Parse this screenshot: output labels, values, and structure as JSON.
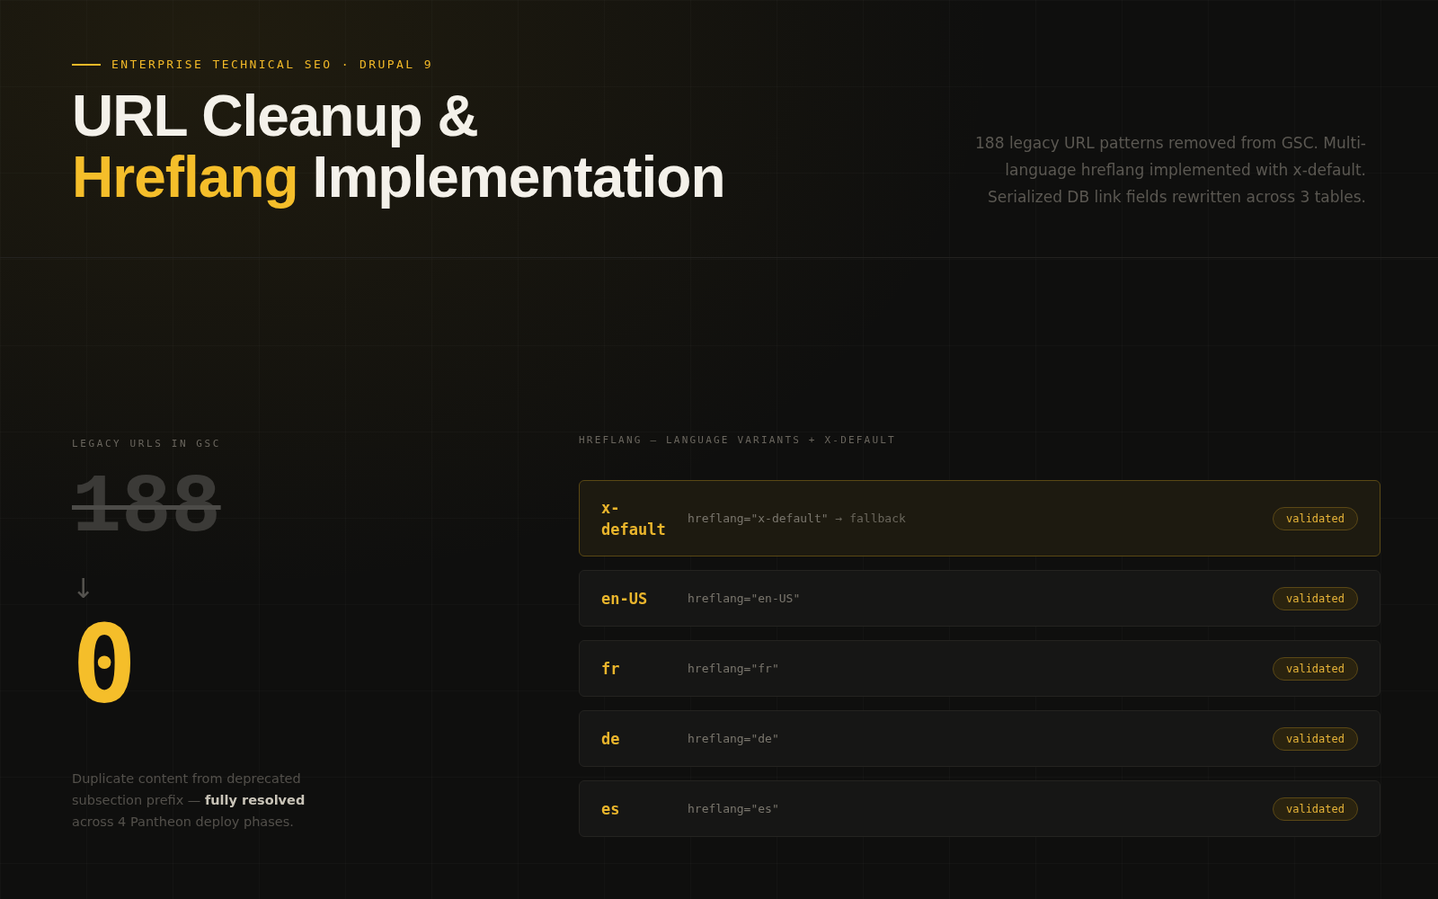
{
  "header": {
    "eyebrow": "ENTERPRISE TECHNICAL SEO · DRUPAL 9",
    "title_line_1": "URL Cleanup &",
    "title_accent": "Hreflang",
    "title_rest": "Implementation",
    "description": "188 legacy URL patterns removed from GSC. Multi-language hreflang implemented with x-default. Serialized DB link fields rewritten across 3 tables."
  },
  "stat": {
    "label": "LEGACY URLS IN GSC",
    "before": "188",
    "arrow": "↓",
    "after": "0",
    "description": "Duplicate content from deprecated subsection prefix — **fully resolved** across 4 Pantheon deploy phases."
  },
  "hreflang": {
    "label": "HREFLANG — LANGUAGE VARIANTS + X-DEFAULT",
    "rows": [
      {
        "lang": "x-default",
        "code": "hreflang=\"x-default\"",
        "note": "→ fallback",
        "status": "validated",
        "highlighted": true
      },
      {
        "lang": "en-US",
        "code": "hreflang=\"en-US\"",
        "status": "validated",
        "highlighted": false
      },
      {
        "lang": "fr",
        "code": "hreflang=\"fr\"",
        "status": "validated",
        "highlighted": false
      },
      {
        "lang": "de",
        "code": "hreflang=\"de\"",
        "status": "validated",
        "highlighted": false
      },
      {
        "lang": "es",
        "code": "hreflang=\"es\"",
        "status": "validated",
        "highlighted": false
      }
    ]
  }
}
